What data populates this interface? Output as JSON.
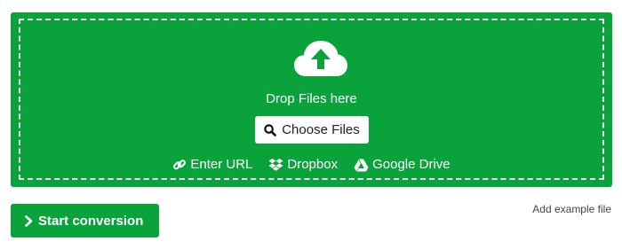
{
  "dropzone": {
    "icon": "cloud-upload-icon",
    "drop_text": "Drop Files here",
    "choose_button_label": "Choose Files",
    "sources": [
      {
        "icon": "link-icon",
        "label": "Enter URL"
      },
      {
        "icon": "dropbox-icon",
        "label": "Dropbox"
      },
      {
        "icon": "google-drive-icon",
        "label": "Google Drive"
      }
    ]
  },
  "actions": {
    "start_label": "Start conversion",
    "example_link": "Add example file"
  },
  "colors": {
    "accent_green": "#0aa23b",
    "text_white": "#ffffff"
  }
}
